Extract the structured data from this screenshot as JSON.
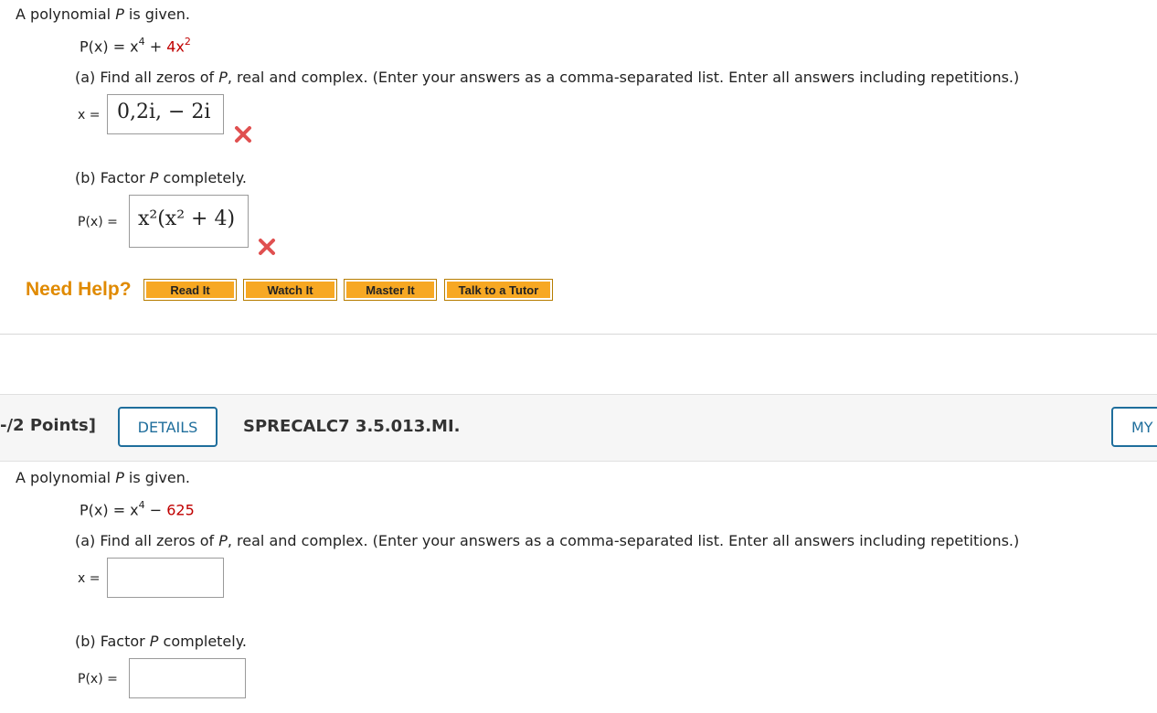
{
  "q1": {
    "intro": "A polynomial P is given.",
    "intro_pre": "A polynomial ",
    "intro_var": "P",
    "intro_post": " is given.",
    "poly_lhs": "P(x) = x",
    "poly_exp1": "4",
    "poly_plus": " + ",
    "poly_red": "4x",
    "poly_exp2": "2",
    "part_a_pre": "(a) Find all zeros of ",
    "part_a_var": "P",
    "part_a_post": ", real and complex. (Enter your answers as a comma-separated list. Enter all answers including repetitions.)",
    "x_label": "x =",
    "answer_a": "0,2i, − 2i",
    "part_b_pre": "(b) Factor ",
    "part_b_var": "P",
    "part_b_post": " completely.",
    "p_label": "P(x) =",
    "answer_b": "x²(x² + 4)",
    "answer_a_status": "incorrect",
    "answer_b_status": "incorrect"
  },
  "help": {
    "label": "Need Help?",
    "buttons": [
      "Read It",
      "Watch It",
      "Master It",
      "Talk to a Tutor"
    ]
  },
  "q2_header": {
    "points": "-/2 Points]",
    "details": "DETAILS",
    "code": "SPRECALC7 3.5.013.MI.",
    "my": "MY"
  },
  "q2": {
    "intro_pre": "A polynomial ",
    "intro_var": "P",
    "intro_post": " is given.",
    "poly_lhs": "P(x) = x",
    "poly_exp1": "4",
    "poly_minus": " − ",
    "poly_red": "625",
    "part_a_pre": "(a) Find all zeros of ",
    "part_a_var": "P",
    "part_a_post": ", real and complex. (Enter your answers as a comma-separated list. Enter all answers including repetitions.)",
    "x_label": "x =",
    "answer_a": "",
    "part_b_pre": "(b) Factor ",
    "part_b_var": "P",
    "part_b_post": " completely.",
    "p_label": "P(x) =",
    "answer_b": ""
  },
  "colors": {
    "accent_blue": "#1f6e9c",
    "need_help_orange": "#e08a00",
    "button_orange": "#f7a823",
    "red_text": "#c00000",
    "x_mark": "#e05050"
  }
}
